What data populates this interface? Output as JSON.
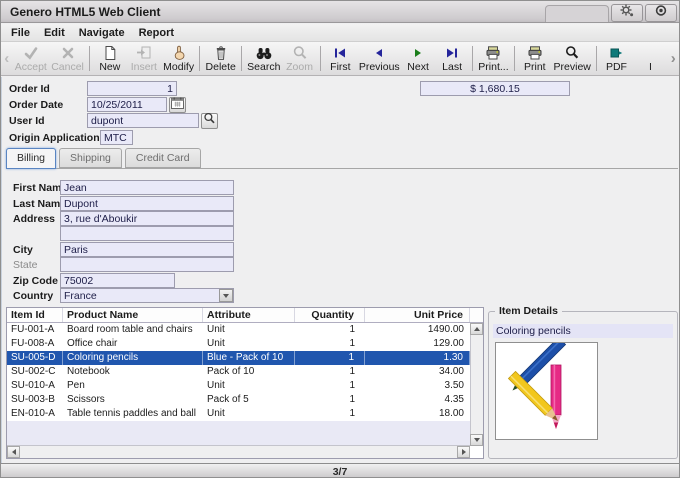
{
  "titlebar": {
    "title": "Genero HTML5 Web Client"
  },
  "menubar": {
    "items": [
      {
        "label": "File"
      },
      {
        "label": "Edit"
      },
      {
        "label": "Navigate"
      },
      {
        "label": "Report"
      }
    ]
  },
  "toolbar": {
    "items": [
      {
        "label": "Accept",
        "disabled": true
      },
      {
        "label": "Cancel",
        "disabled": true
      },
      {
        "label": "New",
        "disabled": false
      },
      {
        "label": "Insert",
        "disabled": true
      },
      {
        "label": "Modify",
        "disabled": false
      },
      {
        "label": "Delete",
        "disabled": false
      },
      {
        "label": "Search",
        "disabled": false
      },
      {
        "label": "Zoom",
        "disabled": true
      },
      {
        "label": "First",
        "disabled": false
      },
      {
        "label": "Previous",
        "disabled": false
      },
      {
        "label": "Next",
        "disabled": false
      },
      {
        "label": "Last",
        "disabled": false
      },
      {
        "label": "Print...",
        "disabled": false
      },
      {
        "label": "Print",
        "disabled": false
      },
      {
        "label": "Preview",
        "disabled": false
      },
      {
        "label": "PDF",
        "disabled": false
      },
      {
        "label": "I",
        "disabled": false,
        "partially_visible": true
      }
    ]
  },
  "order_header": {
    "order_id": {
      "label": "Order Id",
      "value": "1"
    },
    "order_date": {
      "label": "Order Date",
      "value": "10/25/2011"
    },
    "user_id": {
      "label": "User Id",
      "value": "dupont"
    },
    "origin_application": {
      "label": "Origin Application",
      "value": "MTC"
    },
    "total_amount": "$ 1,680.15"
  },
  "tabs": {
    "items": [
      {
        "label": "Billing",
        "active": true
      },
      {
        "label": "Shipping",
        "active": false
      },
      {
        "label": "Credit Card",
        "active": false
      }
    ]
  },
  "billing": {
    "first_name": {
      "label": "First Name",
      "value": "Jean"
    },
    "last_name": {
      "label": "Last Name",
      "value": "Dupont"
    },
    "address": {
      "label": "Address",
      "value": "3, rue d'Aboukir"
    },
    "address2": {
      "value": ""
    },
    "city": {
      "label": "City",
      "value": "Paris"
    },
    "state": {
      "label": "State",
      "value": ""
    },
    "zip_code": {
      "label": "Zip Code",
      "value": "75002"
    },
    "country": {
      "label": "Country",
      "value": "France"
    }
  },
  "items_table": {
    "columns": [
      "Item Id",
      "Product Name",
      "Attribute",
      "Quantity",
      "Unit Price"
    ],
    "selected_index": 2,
    "rows": [
      [
        "FU-001-A",
        "Board room table and chairs",
        "Unit",
        "1",
        "1490.00"
      ],
      [
        "FU-008-A",
        "Office chair",
        "Unit",
        "1",
        "129.00"
      ],
      [
        "SU-005-D",
        "Coloring pencils",
        "Blue - Pack of 10",
        "1",
        "1.30"
      ],
      [
        "SU-002-C",
        "Notebook",
        "Pack of 10",
        "1",
        "34.00"
      ],
      [
        "SU-010-A",
        "Pen",
        "Unit",
        "1",
        "3.50"
      ],
      [
        "SU-003-B",
        "Scissors",
        "Pack of 5",
        "1",
        "4.35"
      ],
      [
        "EN-010-A",
        "Table tennis paddles and ball",
        "Unit",
        "1",
        "18.00"
      ]
    ]
  },
  "item_details": {
    "title": "Item Details",
    "product_name": "Coloring pencils"
  },
  "statusbar": {
    "record_position": "3/7"
  },
  "colors": {
    "selection": "#2056ae",
    "field_bg": "#e9e9f8",
    "nav_blue": "#25259b",
    "nav_green": "#1b7e1b",
    "pdf_teal": "#0e7a7a"
  }
}
